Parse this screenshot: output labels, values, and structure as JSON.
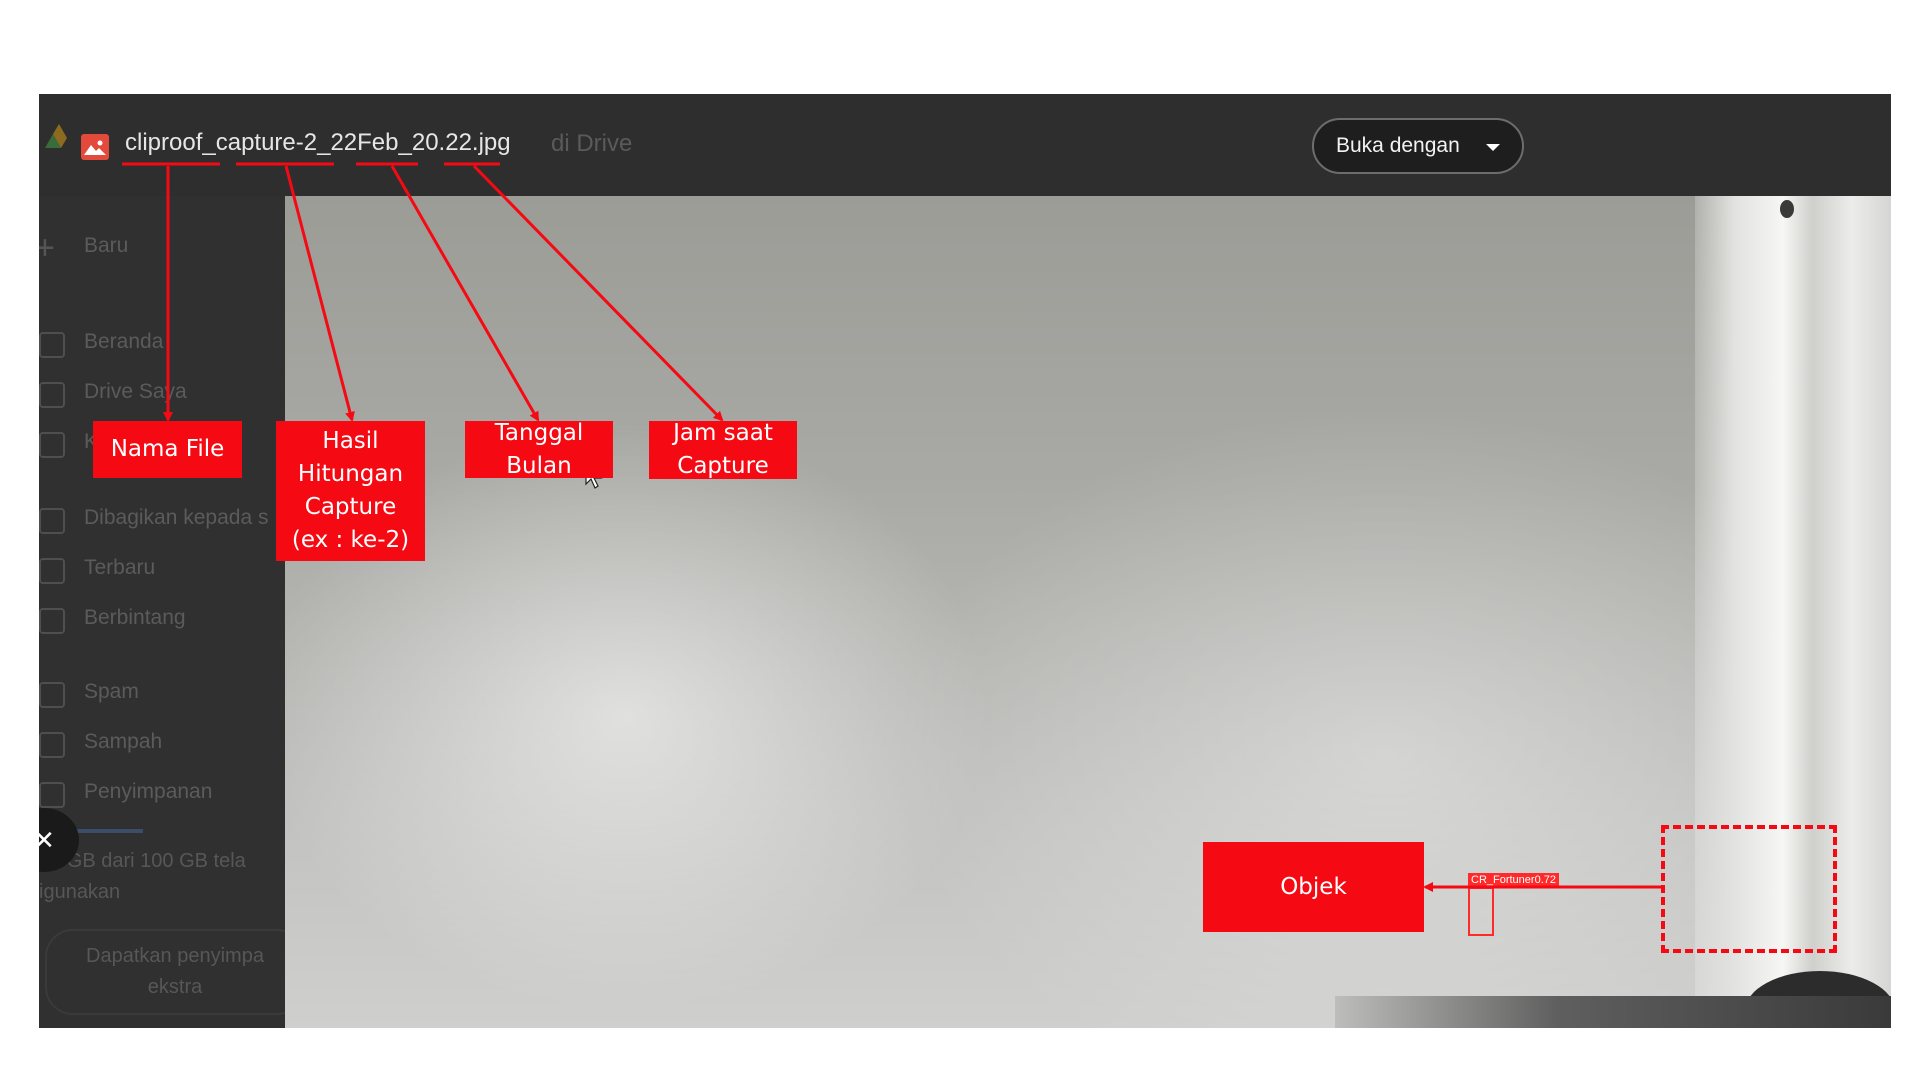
{
  "topbar": {
    "file_name": "cliproof_capture-2_22Feb_20.22.jpg",
    "faded_suffix": "di Drive",
    "open_with_label": "Buka dengan"
  },
  "sidebar": {
    "new_label": "Baru",
    "items": [
      {
        "label": "Beranda",
        "icon": "home-icon"
      },
      {
        "label": "Drive Saya",
        "icon": "drive-icon"
      },
      {
        "label": "K",
        "icon": "computers-icon"
      },
      {
        "label": "Dibagikan kepada s",
        "icon": "shared-icon"
      },
      {
        "label": "Terbaru",
        "icon": "clock-icon"
      },
      {
        "label": "Berbintang",
        "icon": "star-icon"
      },
      {
        "label": "Spam",
        "icon": "spam-icon"
      },
      {
        "label": "Sampah",
        "icon": "trash-icon"
      },
      {
        "label": "Penyimpanan",
        "icon": "cloud-icon"
      }
    ],
    "storage_text_1": "48 GB dari 100 GB tela",
    "storage_text_2": "igunakan",
    "extra_button_1": "Dapatkan penyimpa",
    "extra_button_2": "ekstra"
  },
  "viewer": {
    "detection_label": "CR_Fortuner0.72"
  },
  "annotations": {
    "nama_file": "Nama File",
    "hasil_1": "Hasil",
    "hasil_2": "Hitungan",
    "hasil_3": "Capture",
    "hasil_4": "(ex : ke-2)",
    "tanggal_1": "Tanggal",
    "tanggal_2": "Bulan",
    "jam_1": "Jam saat",
    "jam_2": "Capture",
    "objek": "Objek"
  },
  "colors": {
    "annotation_red": "#f50a14",
    "topbar": "#2e2e2e"
  }
}
